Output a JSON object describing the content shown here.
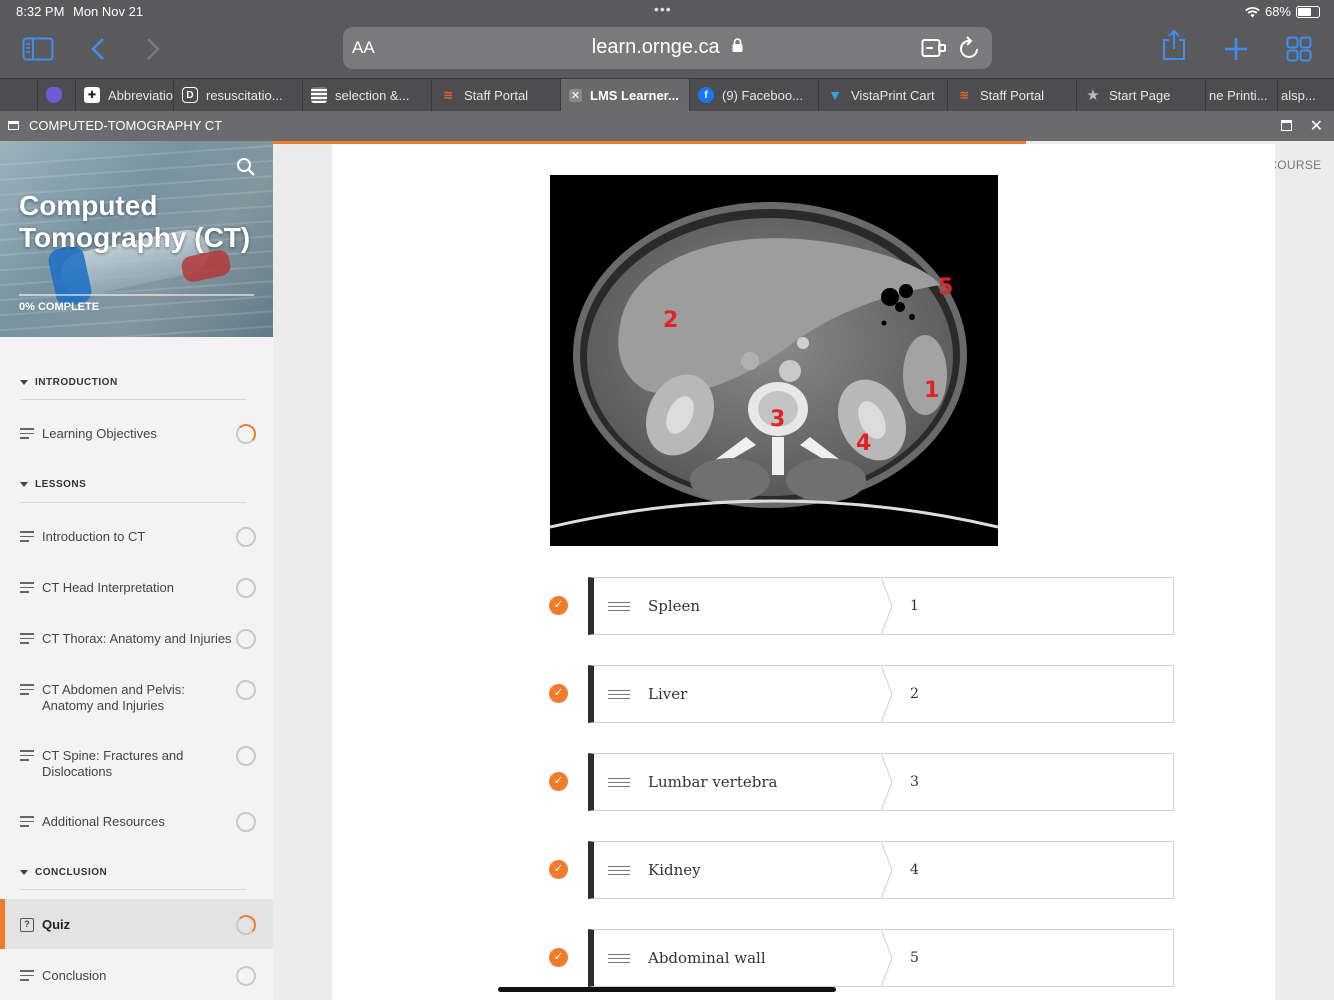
{
  "status": {
    "time": "8:32 PM",
    "date": "Mon Nov 21",
    "battery": "68%",
    "battery_level": 0.68
  },
  "browser": {
    "aa_label": "AA",
    "url": "learn.ornge.ca"
  },
  "tabs": [
    {
      "label": "",
      "icon": "blank-tab-icon",
      "color": "#4d4d4f"
    },
    {
      "label": "",
      "icon": "shield-favicon",
      "color": "#6b5bd6"
    },
    {
      "label": "Abbreviatio",
      "icon": "medical-favicon",
      "color": "#222222"
    },
    {
      "label": "resuscitatio...",
      "icon": "d-favicon",
      "color": "#4d4d4f"
    },
    {
      "label": "selection &...",
      "icon": "table-favicon",
      "color": "#777777"
    },
    {
      "label": "Staff Portal",
      "icon": "ornge-favicon",
      "color": "#e8662a"
    },
    {
      "label": "LMS Learner...",
      "icon": "close-tab-icon",
      "color": "#8a8a8a"
    },
    {
      "label": "(9) Faceboo...",
      "icon": "facebook-favicon",
      "color": "#1877f2"
    },
    {
      "label": "VistaPrint Cart",
      "icon": "vistaprint-favicon",
      "color": "#2aa4e4"
    },
    {
      "label": "Staff Portal",
      "icon": "ornge-favicon",
      "color": "#e8662a"
    },
    {
      "label": "Start Page",
      "icon": "star-icon",
      "color": "#bbbbbb"
    },
    {
      "label": "ne Printi...",
      "icon": "",
      "color": ""
    },
    {
      "label": "alsp...",
      "icon": "",
      "color": ""
    }
  ],
  "course": {
    "window_title": "COMPUTED-TOMOGRAPHY CT",
    "title": "Computed Tomography (CT)",
    "progress_label": "0% COMPLETE",
    "progress_fraction": 0,
    "exit_label": "EXIT COURSE",
    "accent": "#f07b2b"
  },
  "sidebar": {
    "sections": [
      {
        "heading": "INTRODUCTION",
        "items": [
          {
            "label": "Learning Objectives",
            "status": "in-progress"
          }
        ]
      },
      {
        "heading": "LESSONS",
        "items": [
          {
            "label": "Introduction to CT",
            "status": "not-started"
          },
          {
            "label": "CT Head Interpretation",
            "status": "not-started"
          },
          {
            "label": "CT Thorax: Anatomy and Injuries",
            "status": "not-started"
          },
          {
            "label": "CT Abdomen and Pelvis: Anatomy and Injuries",
            "status": "not-started"
          },
          {
            "label": "CT Spine: Fractures and Dislocations",
            "status": "not-started"
          },
          {
            "label": "Additional Resources",
            "status": "not-started"
          }
        ]
      },
      {
        "heading": "CONCLUSION",
        "items": [
          {
            "label": "Quiz",
            "status": "in-progress",
            "active": true
          },
          {
            "label": "Conclusion",
            "status": "not-started"
          }
        ]
      }
    ]
  },
  "quiz": {
    "lesson_progress_fraction": 0.71,
    "image_labels": [
      "1",
      "2",
      "3",
      "4",
      "5"
    ],
    "matches": [
      {
        "term": "Spleen",
        "answer": "1",
        "correct": true
      },
      {
        "term": "Liver",
        "answer": "2",
        "correct": true
      },
      {
        "term": "Lumbar vertebra",
        "answer": "3",
        "correct": true
      },
      {
        "term": "Kidney",
        "answer": "4",
        "correct": true
      },
      {
        "term": "Abdominal wall",
        "answer": "5",
        "correct": true
      }
    ]
  }
}
